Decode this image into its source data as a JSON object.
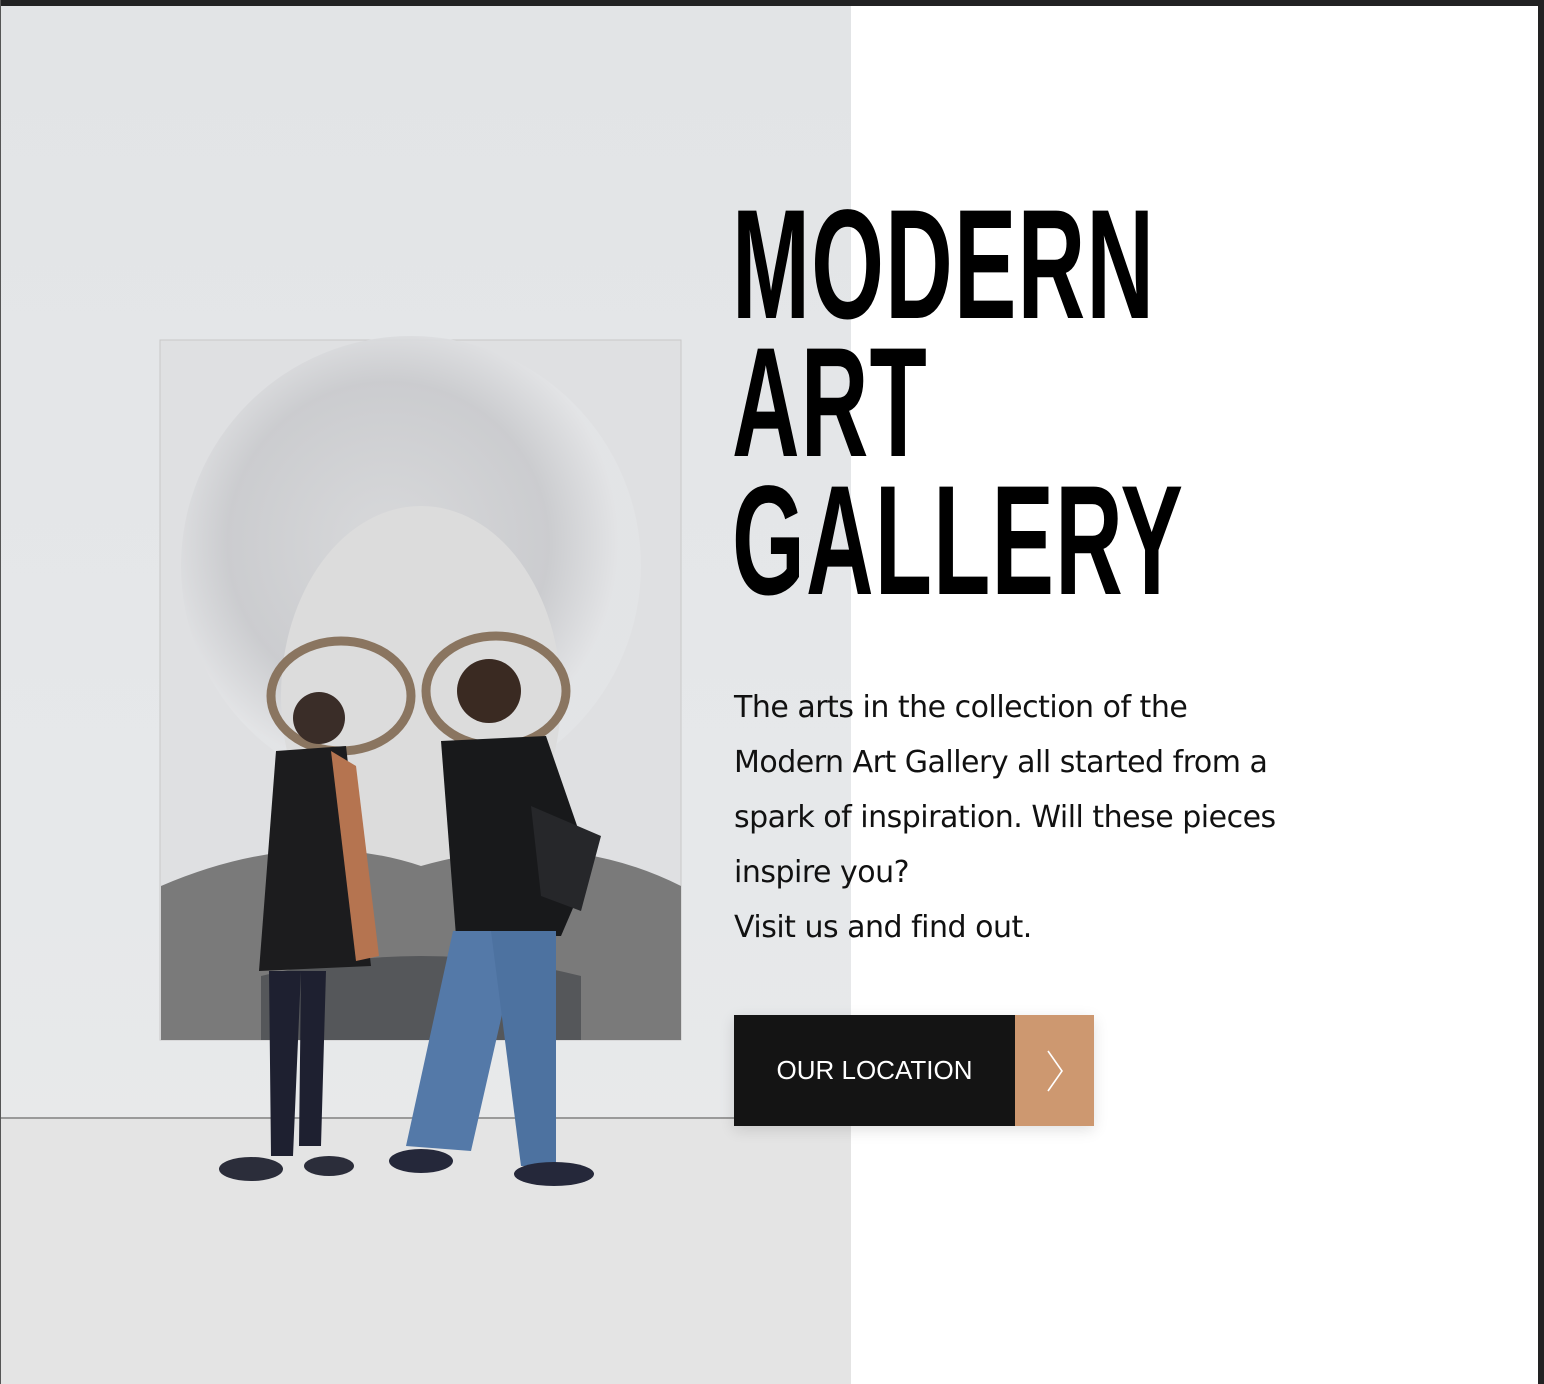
{
  "hero": {
    "title_lines": [
      "MODERN",
      "ART",
      "GALLERY"
    ],
    "description_lines": [
      "The arts in the collection of the",
      "Modern Art Gallery all started from a",
      "spark of inspiration. Will these pieces",
      "inspire you?",
      "Visit us and find out."
    ],
    "cta_label": "OUR LOCATION",
    "cta_icon": "chevron-right-icon",
    "image": "two visitors looking at a large pencil portrait of an elderly woman with glasses"
  },
  "colors": {
    "cta_bg": "#141414",
    "cta_accent": "#cd9870",
    "text": "#000000"
  }
}
